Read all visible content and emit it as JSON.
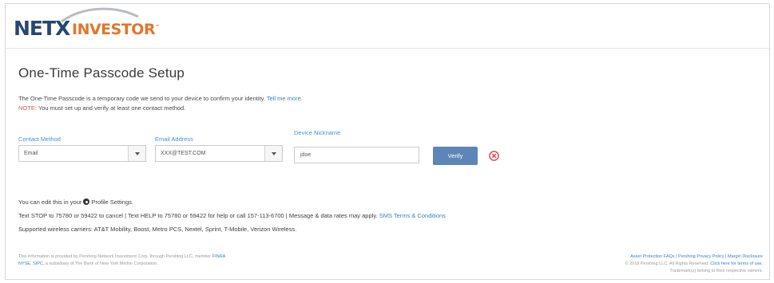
{
  "logo": {
    "part1": "NETX",
    "part2": "INVESTOR",
    "trademark": "™"
  },
  "page_title": "One-Time Passcode Setup",
  "intro": {
    "text": "The One-Time Passcode is a temporary code we send to your device to confirm your identity.",
    "link": "Tell me more."
  },
  "note": {
    "label": "NOTE:",
    "text": "You must set up and verify at least one contact method."
  },
  "form": {
    "contact_method_label": "Contact Method",
    "contact_method_value": "Email",
    "email_label": "Email Address",
    "email_value": "XXX@TEST.COM",
    "nickname_label": "Device Nickname",
    "nickname_value": "jdoe",
    "verify_label": "Verify"
  },
  "footer": {
    "profile_prefix": "You can edit this in your",
    "profile_link": "Profile Settings.",
    "sms_text": "Text STOP to 75780 or 59422 to cancel | Text HELP to 75780 or 59422 for help or call 157-113-6700 | Message & data rates may apply.",
    "sms_link": "SMS Terms & Conditions",
    "carriers": "Supported wireless carriers: AT&T Mobility, Boost, Metro PCS, Nextel, Sprint, T-Mobile, Verizon Wireless."
  },
  "legal_left": {
    "line1": "This information is provided by Pershing Network Investment Corp. through Pershing LLC, member",
    "line1_link": "FINRA",
    "line2_link": "NYSE, SIPC",
    "line2": ", a subsidiary of The Bank of New York Mellon Corporation."
  },
  "legal_right": {
    "links": "Asset Protection FAQs | Pershing Privacy Policy | Margin Disclosure",
    "line2": "© 2018 Pershing LLC. All Rights Reserved.",
    "line2_link": "Click here for terms of use.",
    "line3": "Trademark(s) belong to their respective owners."
  },
  "colors": {
    "brand_navy": "#24486e",
    "brand_orange": "#e2762b",
    "link": "#3d7fbf",
    "note_red": "#d9534f",
    "verify_button": "#5b86b7"
  }
}
